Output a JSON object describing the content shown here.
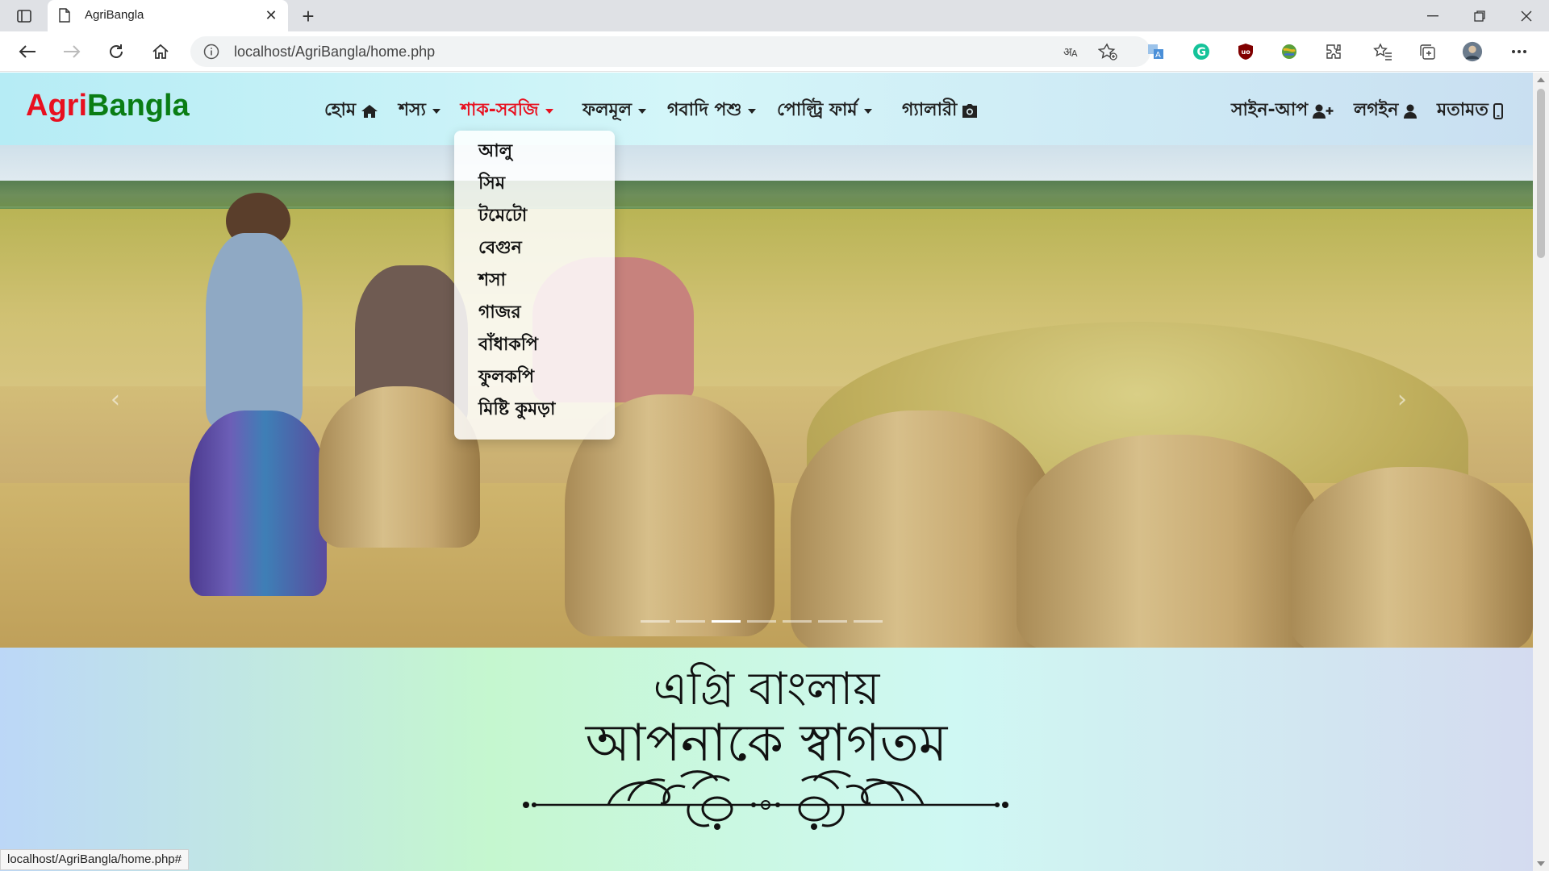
{
  "browser": {
    "tab_title": "AgriBangla",
    "url": "localhost/AgriBangla/home.php",
    "status_url": "localhost/AgriBangla/home.php#"
  },
  "site": {
    "brand_part1": "Agri",
    "brand_part2": "Bangla",
    "brand_colors": {
      "agri": "#e8101f",
      "bangla": "#0a7d14"
    },
    "nav": {
      "home": "হোম",
      "crops": "শস্য",
      "vegetables": "শাক-সবজি",
      "fruits": "ফলমূল",
      "livestock": "গবাদি পশু",
      "poultry": "পোল্ট্রি ফার্ম",
      "gallery": "গ্যালারী",
      "signup": "সাইন-আপ",
      "login": "লগইন",
      "feedback": "মতামত"
    },
    "active_menu_color": "#e8101f",
    "vegetables_dropdown": [
      "আলু",
      "সিম",
      "টমেটো",
      "বেগুন",
      "শসা",
      "গাজর",
      "বাঁধাকপি",
      "ফুলকপি",
      "মিষ্টি কুমড়া"
    ],
    "carousel": {
      "slide_count": 7,
      "active_slide": 3
    },
    "welcome": {
      "line1": "এগ্রি বাংলায়",
      "line2": "আপনাকে স্বাগতম"
    }
  }
}
